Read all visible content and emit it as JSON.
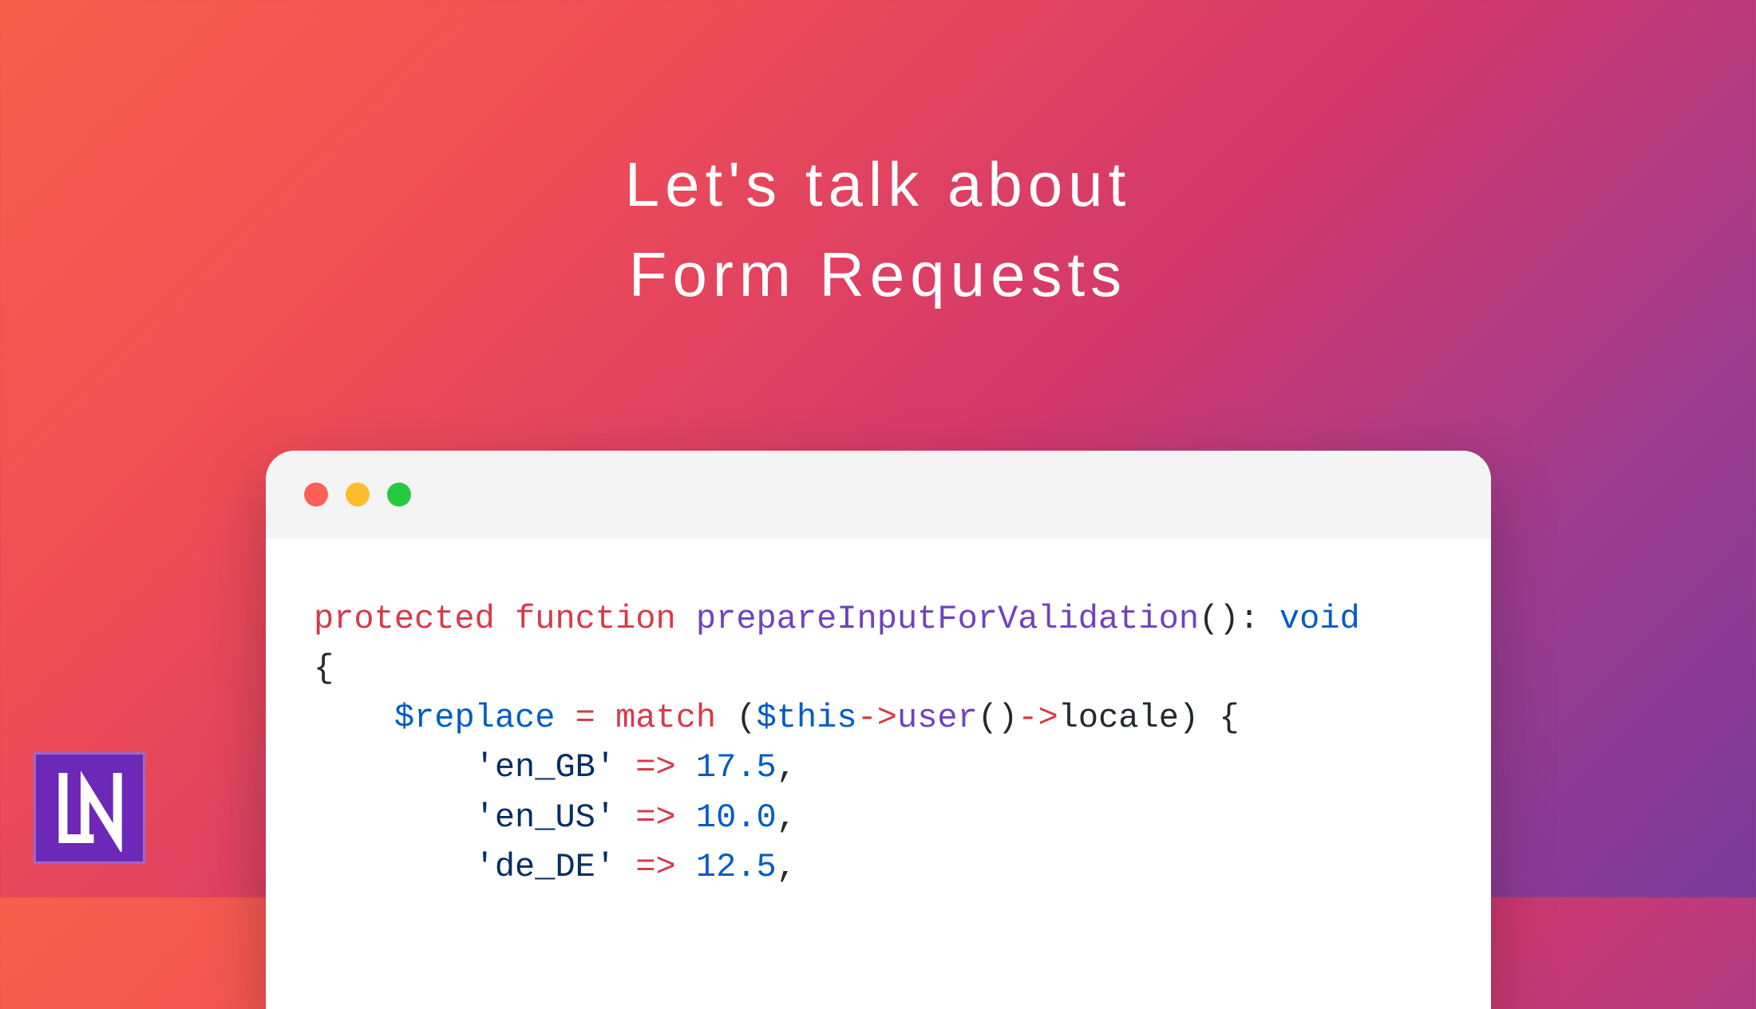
{
  "title_line1": "Let's talk about",
  "title_line2": "Form Requests",
  "code": {
    "kw_protected": "protected",
    "kw_function": "function",
    "fn_name": "prepareInputForValidation",
    "paren_open": "()",
    "colon": ": ",
    "return_type": "void",
    "brace_open": "{",
    "indent1": "    ",
    "var_replace": "$replace",
    "eq": " = ",
    "kw_match": "match",
    "sp": " ",
    "paren_l": "(",
    "var_this": "$this",
    "arrow1": "->",
    "method_user": "user",
    "call_parens": "()",
    "arrow2": "->",
    "prop_locale": "locale",
    "paren_r": ")",
    "brace_open2": " {",
    "indent2": "        ",
    "str_en_gb": "'en_GB'",
    "fat_arrow": " => ",
    "val_en_gb": "17.5",
    "comma": ",",
    "str_en_us": "'en_US'",
    "val_en_us": "10.0",
    "str_de_de": "'de_DE'",
    "val_de_de": "12.5"
  },
  "logo_letters": "LN"
}
